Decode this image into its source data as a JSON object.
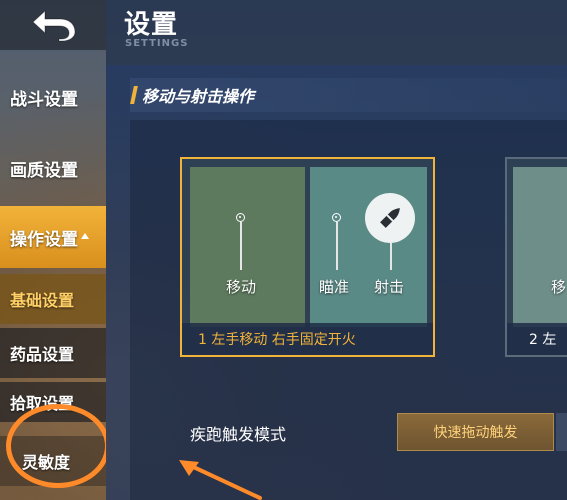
{
  "header": {
    "title": "设置",
    "subtitle": "SETTINGS"
  },
  "sidebar": {
    "items": [
      {
        "label": "战斗设置"
      },
      {
        "label": "画质设置"
      },
      {
        "label": "操作设置"
      },
      {
        "label": "基础设置"
      },
      {
        "label": "药品设置"
      },
      {
        "label": "拾取设置"
      },
      {
        "label": "灵敏度"
      }
    ]
  },
  "section": {
    "title": "移动与射击操作"
  },
  "modes": [
    {
      "caption": "1  左手移动 右手固定开火",
      "zones": {
        "move": "移动",
        "aim": "瞄准",
        "fire": "射击"
      },
      "selected": true
    },
    {
      "caption": "2 左",
      "zones": {
        "move": "移"
      },
      "selected": false
    }
  ],
  "sprint": {
    "label": "疾跑触发模式",
    "selected_option": "快速拖动触发"
  },
  "colors": {
    "accent": "#f2b33a",
    "annotation": "#ff8a2a",
    "panel": "#1a3058"
  },
  "icons": [
    "back-arrow-icon",
    "bullet-icon",
    "triangle-up-icon"
  ]
}
